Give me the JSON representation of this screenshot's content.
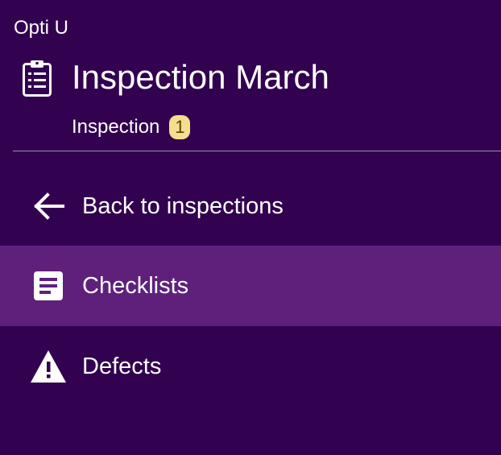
{
  "app": {
    "name": "Opti U"
  },
  "header": {
    "icon": "clipboard-list-icon",
    "title": "Inspection March",
    "subtitle": "Inspection",
    "badge_count": "1"
  },
  "colors": {
    "background": "#320150",
    "active_item": "#5f207c",
    "badge_background": "#f7dd8e",
    "badge_text": "#5a4306",
    "divider": "#a48bb5",
    "text": "#ffffff"
  },
  "nav": {
    "items": [
      {
        "label": "Back to inspections",
        "icon": "arrow-left-icon",
        "active": false
      },
      {
        "label": "Checklists",
        "icon": "document-text-icon",
        "active": true
      },
      {
        "label": "Defects",
        "icon": "warning-triangle-icon",
        "active": false
      }
    ]
  }
}
